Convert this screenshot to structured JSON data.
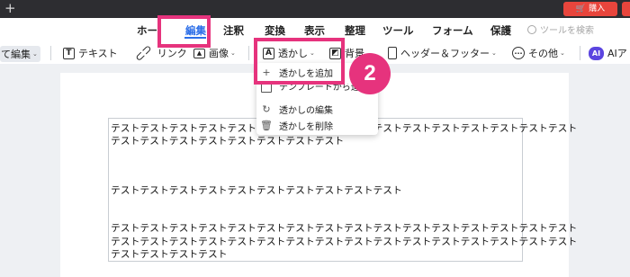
{
  "titlebar": {
    "new_tab_icon": "plus-icon",
    "buy_label": "購入",
    "buy_icon": "cart-icon",
    "buy_color": "#e8453c"
  },
  "menu": {
    "tabs": [
      {
        "label": "ホー"
      },
      {
        "label": "編集",
        "active": true
      },
      {
        "label": "注釈"
      },
      {
        "label": "変換"
      },
      {
        "label": "表示"
      },
      {
        "label": "整理"
      },
      {
        "label": "ツール"
      },
      {
        "label": "フォーム"
      },
      {
        "label": "保護"
      }
    ],
    "active_color": "#2b6ee8",
    "search_placeholder": "ツールを検索"
  },
  "toolbar": {
    "all_edit": "て編集",
    "text": "テキスト",
    "link": "リンク",
    "image": "画像",
    "watermark": "透かし",
    "background": "背景",
    "header_footer": "ヘッダー＆フッター",
    "more": "その他",
    "ai": "AIア",
    "ai_icon": "AI"
  },
  "dropdown": {
    "items": [
      {
        "label": "透かしを追加",
        "icon": "plus-icon"
      },
      {
        "label": "テンプレートから追加",
        "icon": "template-icon"
      },
      {
        "label": "透かしの編集",
        "icon": "refresh-icon"
      },
      {
        "label": "透かしを削除",
        "icon": "trash-icon"
      }
    ]
  },
  "document": {
    "lines": [
      "テストテストテストテストテストテストテストテストテストテストテストテストテストテストテストテスト",
      "テストテストテストテストテストテストテストテスト",
      "テストテストテストテストテストテストテストテストテストテスト",
      "テストテストテストテストテストテストテストテストテストテストテストテストテストテストテストテスト",
      "テストテストテストテストテストテストテストテストテストテストテストテストテストテストテストテスト",
      "テストテストテストテスト"
    ]
  },
  "annotation": {
    "step_number": "2",
    "highlight_color": "#e6337d"
  }
}
